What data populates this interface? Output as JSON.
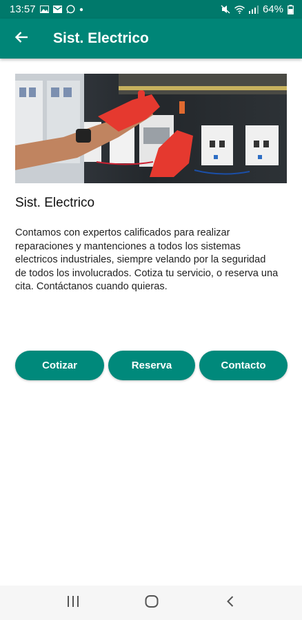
{
  "status_bar": {
    "time": "13:57",
    "battery": "64%",
    "left_icons": [
      "image-icon",
      "mail-icon",
      "whatsapp-icon",
      "dot-icon"
    ],
    "right_icons": [
      "mute-icon",
      "wifi-icon",
      "signal-icon",
      "battery-icon"
    ]
  },
  "app_bar": {
    "title": "Sist. Electrico",
    "back_icon": "arrow-left-icon"
  },
  "hero_image": {
    "description": "electrician-panel-photo"
  },
  "content": {
    "title": "Sist. Electrico",
    "description": "Contamos con expertos calificados para realizar reparaciones y mantenciones a todos los sistemas electricos industriales, siempre velando por la seguridad de todos los involucrados. Cotiza tu servicio, o reserva una cita. Contáctanos cuando quieras."
  },
  "actions": {
    "cotizar": "Cotizar",
    "reserva": "Reserva",
    "contacto": "Contacto"
  },
  "nav_bar": {
    "icons": [
      "recents-icon",
      "home-icon",
      "back-icon"
    ]
  },
  "colors": {
    "primary": "#008577",
    "primary_dark": "#00796b",
    "button": "#00897b"
  }
}
